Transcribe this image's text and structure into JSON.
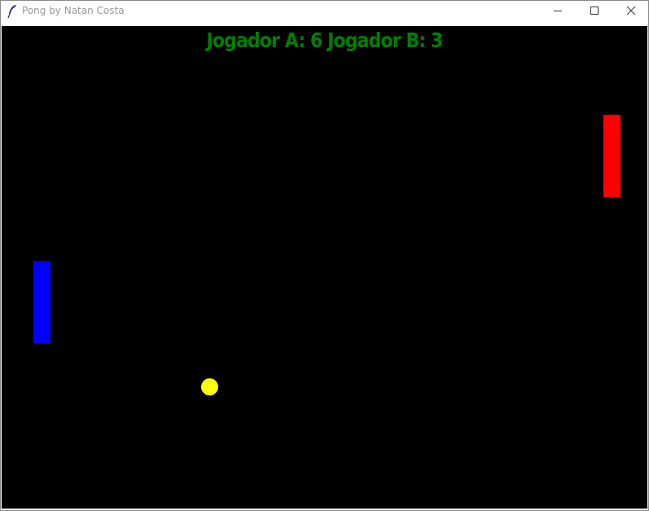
{
  "window": {
    "title": "Pong by Natan Costa",
    "app_icon": "feather-icon",
    "controls": {
      "minimize_icon": "minimize-icon",
      "maximize_icon": "maximize-icon",
      "close_icon": "close-icon"
    }
  },
  "game": {
    "background_color": "#000000",
    "score_text": "Jogador A: 6 Jogador B: 3",
    "score_color": "#008000",
    "player_a": {
      "name": "Jogador A",
      "score": 6,
      "paddle_color": "#0000ff"
    },
    "player_b": {
      "name": "Jogador B",
      "score": 3,
      "paddle_color": "#ff0000"
    },
    "ball_color": "#ffff00"
  }
}
